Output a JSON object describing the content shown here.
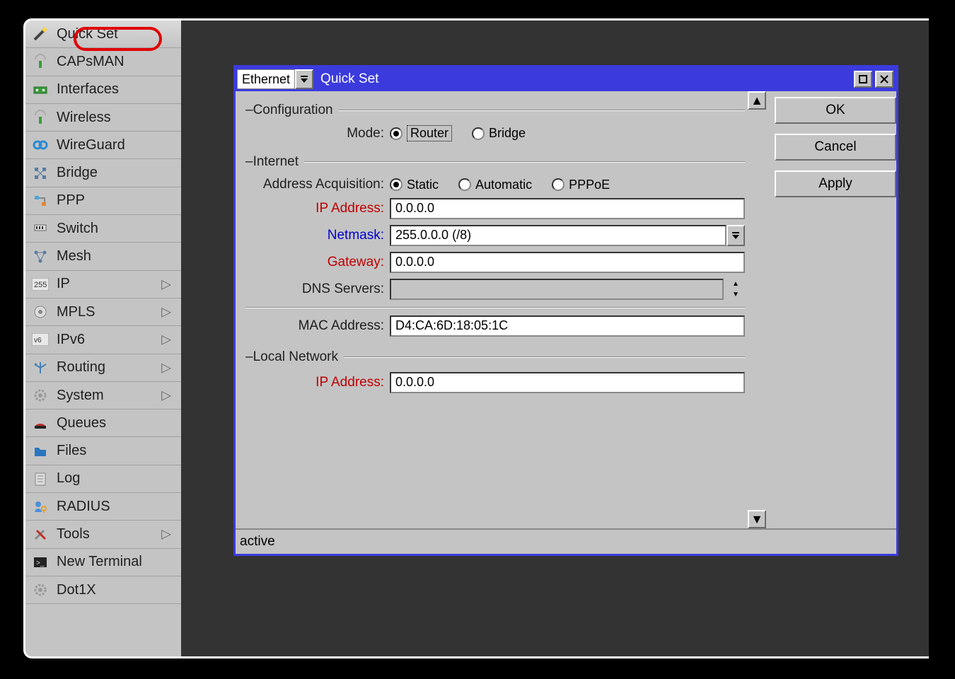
{
  "sidebar": {
    "items": [
      {
        "label": "Quick Set",
        "submenu": false
      },
      {
        "label": "CAPsMAN",
        "submenu": false
      },
      {
        "label": "Interfaces",
        "submenu": false
      },
      {
        "label": "Wireless",
        "submenu": false
      },
      {
        "label": "WireGuard",
        "submenu": false
      },
      {
        "label": "Bridge",
        "submenu": false
      },
      {
        "label": "PPP",
        "submenu": false
      },
      {
        "label": "Switch",
        "submenu": false
      },
      {
        "label": "Mesh",
        "submenu": false
      },
      {
        "label": "IP",
        "submenu": true
      },
      {
        "label": "MPLS",
        "submenu": true
      },
      {
        "label": "IPv6",
        "submenu": true
      },
      {
        "label": "Routing",
        "submenu": true
      },
      {
        "label": "System",
        "submenu": true
      },
      {
        "label": "Queues",
        "submenu": false
      },
      {
        "label": "Files",
        "submenu": false
      },
      {
        "label": "Log",
        "submenu": false
      },
      {
        "label": "RADIUS",
        "submenu": false
      },
      {
        "label": "Tools",
        "submenu": true
      },
      {
        "label": "New Terminal",
        "submenu": false
      },
      {
        "label": "Dot1X",
        "submenu": false
      }
    ]
  },
  "dialog": {
    "interface_select": "Ethernet",
    "title": "Quick Set",
    "buttons": {
      "ok": "OK",
      "cancel": "Cancel",
      "apply": "Apply"
    },
    "groups": {
      "configuration": {
        "label": "Configuration",
        "mode_label": "Mode:",
        "mode_options": {
          "router": "Router",
          "bridge": "Bridge"
        },
        "mode_value": "router"
      },
      "internet": {
        "label": "Internet",
        "acq_label": "Address Acquisition:",
        "acq_options": {
          "static": "Static",
          "automatic": "Automatic",
          "pppoe": "PPPoE"
        },
        "acq_value": "static",
        "ip_label": "IP Address:",
        "ip_value": "0.0.0.0",
        "netmask_label": "Netmask:",
        "netmask_value": "255.0.0.0 (/8)",
        "gateway_label": "Gateway:",
        "gateway_value": "0.0.0.0",
        "dns_label": "DNS Servers:",
        "dns_value": "",
        "mac_label": "MAC Address:",
        "mac_value": "D4:CA:6D:18:05:1C"
      },
      "local": {
        "label": "Local Network",
        "ip_label": "IP Address:",
        "ip_value": "0.0.0.0"
      }
    },
    "status": "active"
  }
}
